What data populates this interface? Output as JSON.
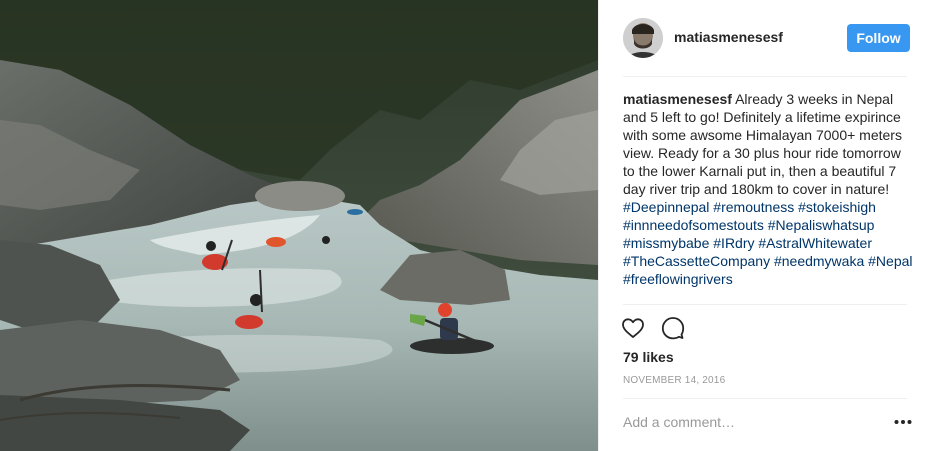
{
  "post": {
    "username": "matiasmenesesf",
    "follow_label": "Follow",
    "caption": {
      "username": "matiasmenesesf",
      "text": "Already 3 weeks in Nepal and 5 left to go! Definitely a lifetime expirince with some awsome Himalayan 7000+ meters view. Ready for a 30 plus hour ride tomorrow to the lower Karnali put in, then a beautiful 7 day river trip and 180km to cover in nature!",
      "hashtags": [
        "#Deepinnepal",
        "#remoutness",
        "#stokeishigh",
        "#innneedofsomestouts",
        "#Nepaliswhatsup",
        "#missmybabe",
        "#IRdry",
        "#AstralWhitewater",
        "#TheCassetteCompany",
        "#needmywaka",
        "#Nepal",
        "#freeflowingrivers"
      ]
    },
    "likes_text": "79 likes",
    "date_text": "NOVEMBER 14, 2016",
    "comment_placeholder": "Add a comment…"
  },
  "icons": {
    "like": "heart-icon",
    "comment": "comment-bubble-icon",
    "more": "more-options-icon"
  },
  "colors": {
    "follow_button": "#3897f0",
    "hashtag": "#003569",
    "meta": "#999999"
  }
}
